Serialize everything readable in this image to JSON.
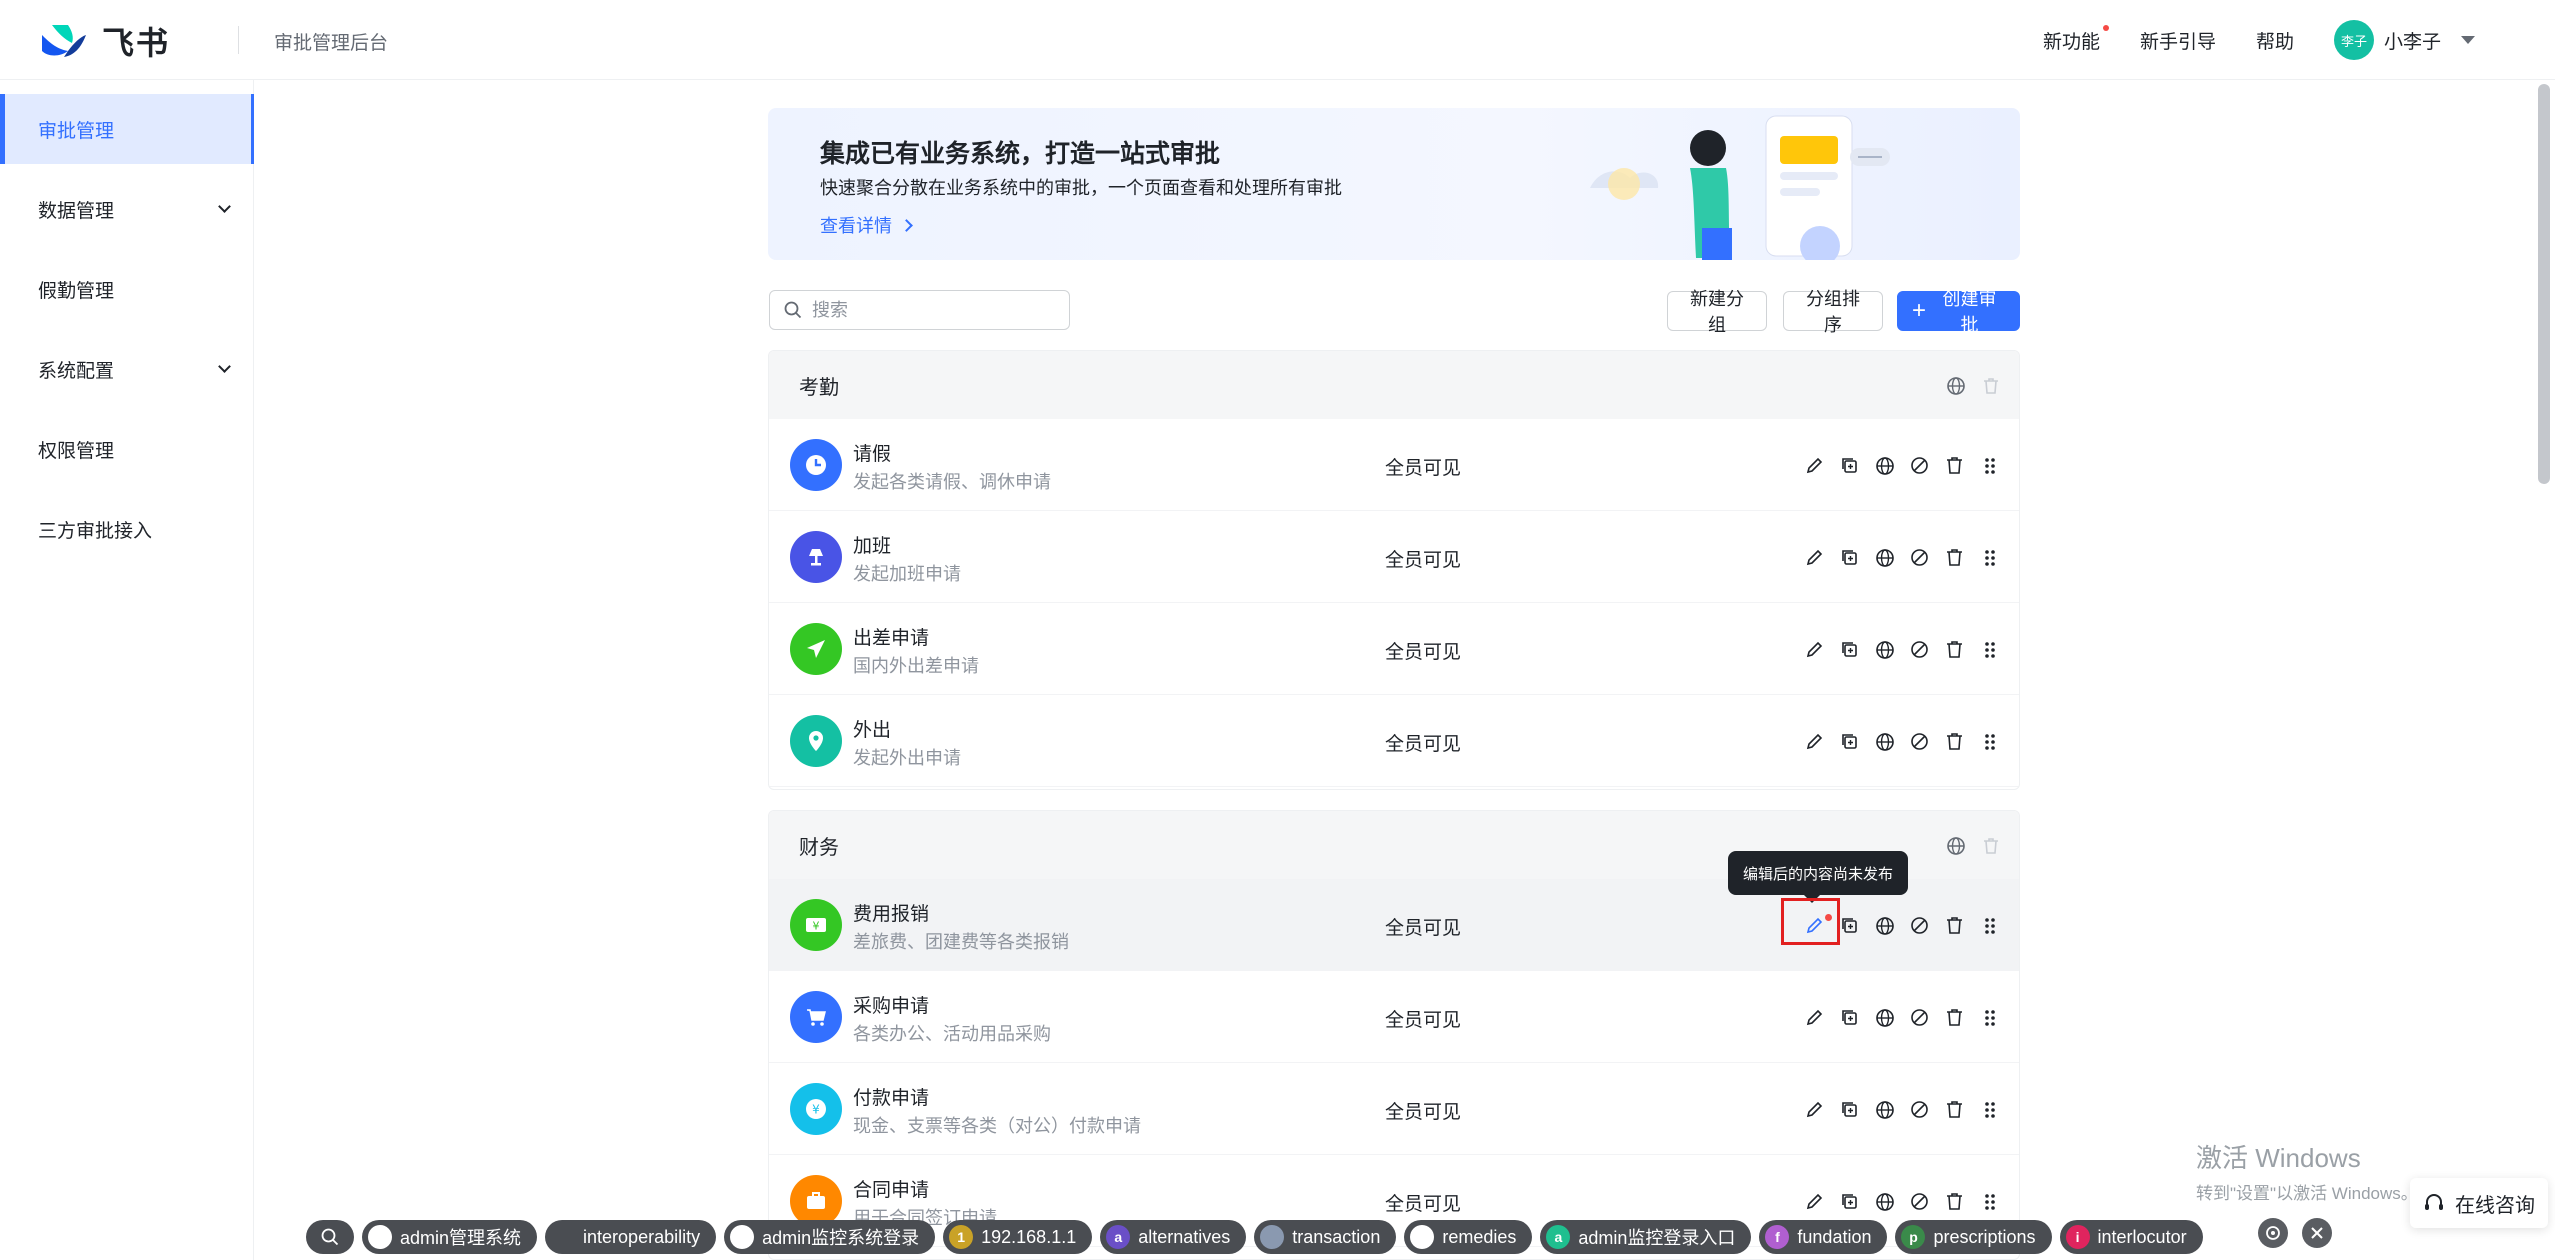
{
  "header": {
    "logo_text": "飞书",
    "subtitle": "审批管理后台",
    "links": [
      "新功能",
      "新手引导",
      "帮助"
    ],
    "user_avatar": "李子",
    "user_name": "小李子"
  },
  "sidebar": {
    "items": [
      {
        "label": "审批管理",
        "active": true
      },
      {
        "label": "数据管理",
        "expandable": true
      },
      {
        "label": "假勤管理"
      },
      {
        "label": "系统配置",
        "expandable": true
      },
      {
        "label": "权限管理"
      },
      {
        "label": "三方审批接入"
      }
    ]
  },
  "banner": {
    "title": "集成已有业务系统，打造一站式审批",
    "desc": "快速聚合分散在业务系统中的审批，一个页面查看和处理所有审批",
    "link": "查看详情"
  },
  "toolbar": {
    "search_placeholder": "搜索",
    "new_group": "新建分组",
    "sort_group": "分组排序",
    "create": "创建审批"
  },
  "groups": [
    {
      "name": "考勤",
      "rows": [
        {
          "name": "请假",
          "desc": "发起各类请假、调休申请",
          "visibility": "全员可见",
          "icon": "clock-icon",
          "color": "#3370ff"
        },
        {
          "name": "加班",
          "desc": "发起加班申请",
          "visibility": "全员可见",
          "icon": "lamp-icon",
          "color": "#4954e6"
        },
        {
          "name": "出差申请",
          "desc": "国内外出差申请",
          "visibility": "全员可见",
          "icon": "plane-icon",
          "color": "#34c724"
        },
        {
          "name": "外出",
          "desc": "发起外出申请",
          "visibility": "全员可见",
          "icon": "location-icon",
          "color": "#14c0a3"
        }
      ]
    },
    {
      "name": "财务",
      "rows": [
        {
          "name": "费用报销",
          "desc": "差旅费、团建费等各类报销",
          "visibility": "全员可见",
          "icon": "yen-bill-icon",
          "color": "#34c724"
        },
        {
          "name": "采购申请",
          "desc": "各类办公、活动用品采购",
          "visibility": "全员可见",
          "icon": "cart-icon",
          "color": "#3370ff"
        },
        {
          "name": "付款申请",
          "desc": "现金、支票等各类（对公）付款申请",
          "visibility": "全员可见",
          "icon": "yen-coin-icon",
          "color": "#14c0ea"
        },
        {
          "name": "合同申请",
          "desc": "用于合同签订申请",
          "visibility": "全员可见",
          "icon": "briefcase-icon",
          "color": "#ff8800"
        }
      ]
    }
  ],
  "tooltip": "编辑后的内容尚未发布",
  "watermark": {
    "title": "激活 Windows",
    "sub": "转到\"设置\"以激活 Windows。"
  },
  "consult": "在线咨询",
  "taskbar": [
    {
      "label": "admin管理系统",
      "badge": "",
      "color": "#ffffff"
    },
    {
      "label": "interoperability",
      "badge": "",
      "color": ""
    },
    {
      "label": "admin监控系统登录",
      "badge": "",
      "color": "#ffffff"
    },
    {
      "label": "192.168.1.1",
      "badge": "1",
      "color": "#c9a227"
    },
    {
      "label": "alternatives",
      "badge": "a",
      "color": "#6a4fc7"
    },
    {
      "label": "transaction",
      "badge": "",
      "color": "#8a99b0"
    },
    {
      "label": "remedies",
      "badge": "",
      "color": "#ffffff"
    },
    {
      "label": "admin监控登录入口",
      "badge": "a",
      "color": "#1fbf8f"
    },
    {
      "label": "fundation",
      "badge": "f",
      "color": "#b05fd0"
    },
    {
      "label": "prescriptions",
      "badge": "p",
      "color": "#3a8a4a"
    },
    {
      "label": "interlocutor",
      "badge": "i",
      "color": "#e0245e"
    }
  ]
}
